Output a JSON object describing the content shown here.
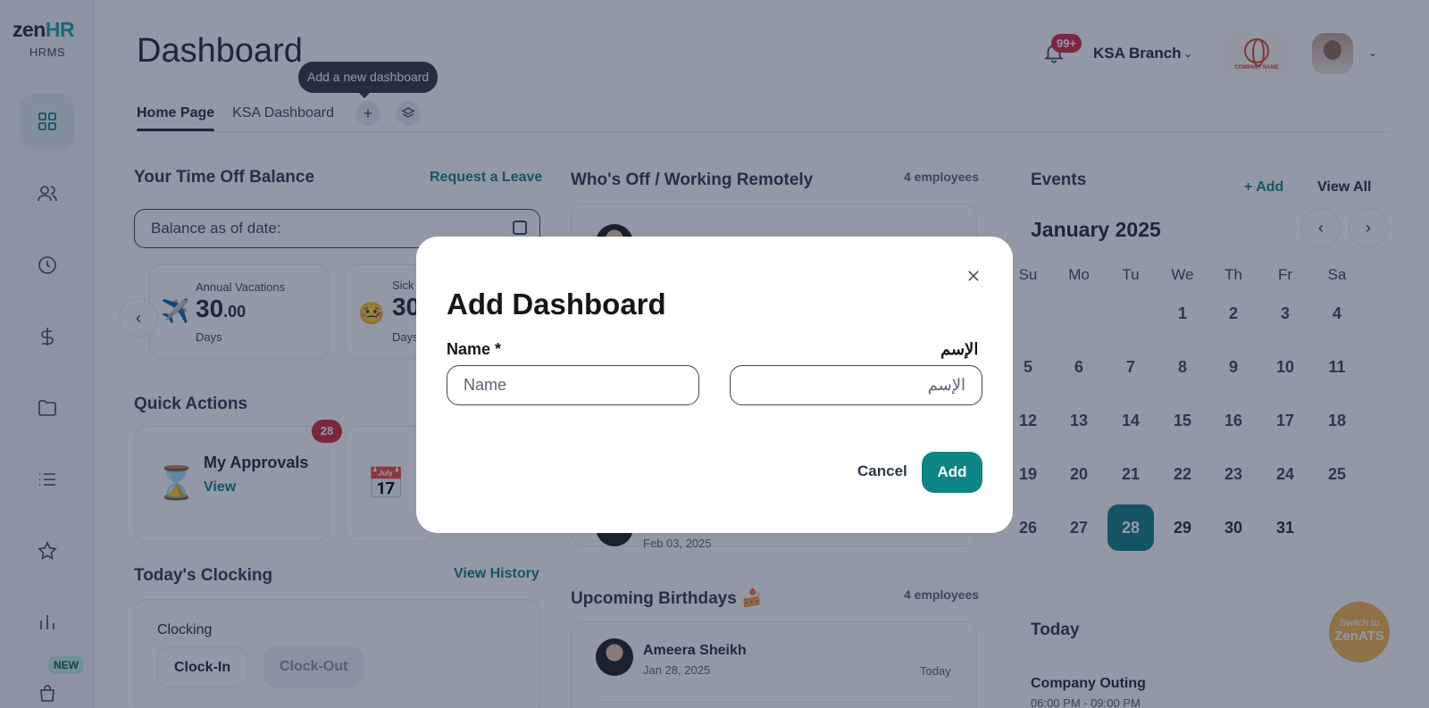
{
  "brand": {
    "logo_main": "zen",
    "logo_accent": "HR",
    "logo_sub": "HRMS",
    "accent_color": "#0e7f7f"
  },
  "sidebar": {
    "items": [
      {
        "icon": "dashboard-icon",
        "active": true
      },
      {
        "icon": "people-icon"
      },
      {
        "icon": "clock-icon"
      },
      {
        "icon": "dollar-icon"
      },
      {
        "icon": "folder-icon"
      },
      {
        "icon": "list-icon"
      },
      {
        "icon": "star-icon"
      },
      {
        "icon": "chart-icon"
      },
      {
        "icon": "shopping-bag-icon"
      }
    ],
    "new_badge": "NEW"
  },
  "header": {
    "title": "Dashboard",
    "notification_count": "99+",
    "branch": "KSA Branch",
    "company_logo_text": "COMPANY NAME"
  },
  "tabs": {
    "items": [
      "Home Page",
      "KSA Dashboard"
    ],
    "active": "Home Page",
    "tooltip": "Add a new dashboard"
  },
  "time_off": {
    "title": "Your Time Off Balance",
    "link": "Request a Leave",
    "date_placeholder": "Balance as of date:",
    "cards": [
      {
        "label": "Annual Vacations",
        "value_int": "30",
        "value_dec": ".00",
        "unit": "Days"
      },
      {
        "label": "Sick",
        "value_int": "30",
        "unit": "Days"
      }
    ]
  },
  "quick_actions": {
    "title": "Quick Actions",
    "approvals": {
      "title": "My Approvals",
      "link": "View",
      "badge": "28"
    }
  },
  "clocking": {
    "title": "Today's Clocking",
    "link": "View History",
    "label": "Clocking",
    "clock_in": "Clock-In",
    "clock_out": "Clock-Out"
  },
  "whos_off": {
    "title": "Who's Off / Working Remotely",
    "meta": "4 employees",
    "last_date": "Feb 03, 2025"
  },
  "birthdays": {
    "title": "Upcoming Birthdays 🍰",
    "meta": "4 employees",
    "person": {
      "name": "Ameera Sheikh",
      "date": "Jan 28, 2025",
      "when": "Today"
    }
  },
  "events": {
    "title": "Events",
    "add": "+ Add",
    "view_all": "View All",
    "month": "January 2025",
    "weekdays": [
      "Su",
      "Mo",
      "Tu",
      "We",
      "Th",
      "Fr",
      "Sa"
    ],
    "first_weekday_index": 3,
    "days_in_month": 31,
    "today": 28,
    "today_title": "Today",
    "event_name": "Company Outing",
    "event_time": "06:00 PM - 09:00 PM"
  },
  "switch": {
    "line1": "Switch to",
    "line2": "ZenATS"
  },
  "modal": {
    "title": "Add Dashboard",
    "name_label": "Name",
    "required_mark": "*",
    "arabic_label": "الإسم",
    "name_placeholder": "Name",
    "arabic_placeholder": "الإسم",
    "cancel": "Cancel",
    "add": "Add"
  }
}
